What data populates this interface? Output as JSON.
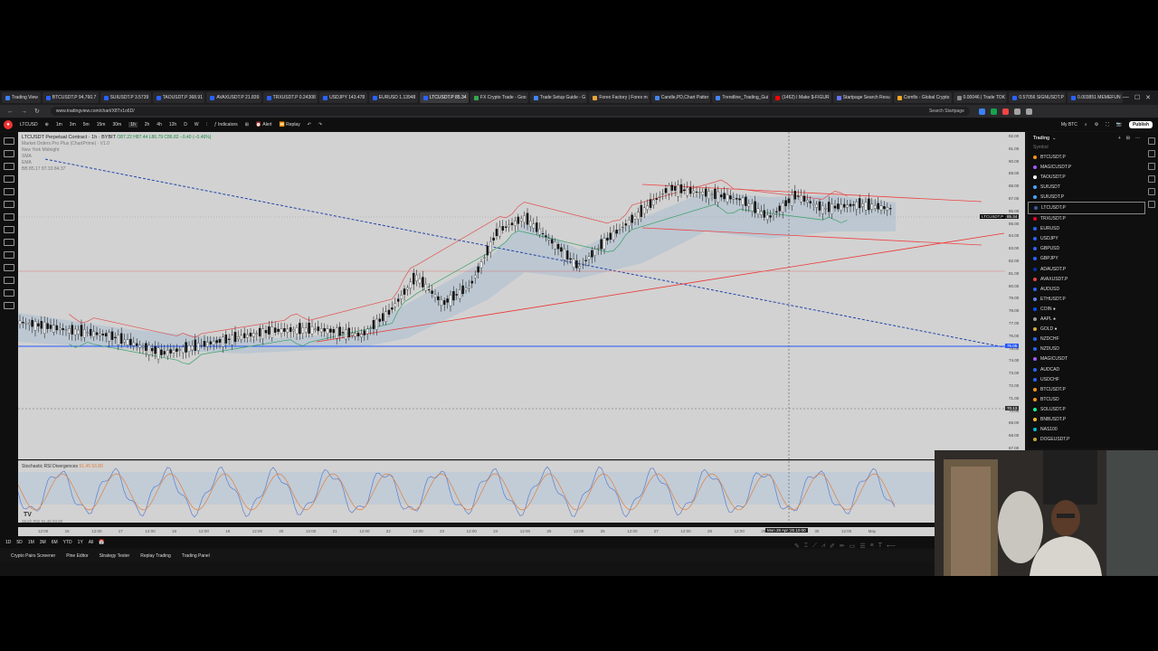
{
  "browser": {
    "tabs": [
      {
        "label": "Trading View",
        "color": "#3b82f6"
      },
      {
        "label": "BTCUSDT.P 94,760.7",
        "color": "#2962ff"
      },
      {
        "label": "SUIUSDT.P 3.5739",
        "color": "#2962ff"
      },
      {
        "label": "TAOUSDT.P 368.91",
        "color": "#2962ff"
      },
      {
        "label": "AVAXUSDT.P 21.839",
        "color": "#2962ff"
      },
      {
        "label": "TRXUSDT.P 0.24308",
        "color": "#2962ff"
      },
      {
        "label": "USDJPY 143.478",
        "color": "#2962ff"
      },
      {
        "label": "EURUSD 1.13948",
        "color": "#2962ff"
      },
      {
        "label": "LTCUSDT.P 85.34",
        "color": "#2962ff",
        "active": true
      },
      {
        "label": "FX Crypto Trade - Goo",
        "color": "#34a853"
      },
      {
        "label": "Trade Setup Guide - G",
        "color": "#4285f4"
      },
      {
        "label": "Forex Factory | Forex m",
        "color": "#e8a33d"
      },
      {
        "label": "Candle,PD,Chart Patter",
        "color": "#4285f4"
      },
      {
        "label": "Trendline_Trading_Gui",
        "color": "#4285f4"
      },
      {
        "label": "(1462) I Make $-FIGUR",
        "color": "#ff0000"
      },
      {
        "label": "Startpage Search Resu",
        "color": "#6573ff"
      },
      {
        "label": "Comfix - Global Crypto",
        "color": "#f5a623"
      },
      {
        "label": "0.00046 | Trade TOK",
        "color": "#888888"
      },
      {
        "label": "0.57056 SIGNUSDT.P",
        "color": "#2962ff"
      },
      {
        "label": "0.003851 MEMEFUN",
        "color": "#2962ff"
      }
    ],
    "url": "www.tradingview.com/chart/X8Tv1o6D/",
    "search_placeholder": "Search Startpage"
  },
  "toolbar": {
    "symbol": "LTCUSD",
    "intervals": [
      "1m",
      "3m",
      "5m",
      "15m",
      "30m",
      "1h",
      "2h",
      "4h",
      "12h",
      "D",
      "W"
    ],
    "indicators_label": "Indicators",
    "alert_label": "Alert",
    "replay_label": "Replay",
    "layout_label": "My BTC",
    "publish_label": "Publish"
  },
  "chart": {
    "title": "LTCUSDT Perpetual Contract · 1h · BYBIT",
    "ohlc": "O87.22 H87.44 L86.79 C86.82 −0.40 (−0.46%)",
    "indicator1": "Market Orders Pro Plus (ChartPrime) · V1.0",
    "session": "New York Midnight",
    "ma1": "SMA",
    "ma2": "EMA",
    "bb": "BB 85.17 87.33 84.37",
    "price_labels": [
      "92.00",
      "91.00",
      "90.00",
      "89.00",
      "88.00",
      "87.00",
      "86.00",
      "85.00",
      "84.00",
      "83.00",
      "82.00",
      "81.00",
      "80.00",
      "79.00",
      "78.00",
      "77.00",
      "76.00",
      "75.00",
      "74.00",
      "73.00",
      "72.00",
      "71.00",
      "70.00",
      "69.00",
      "68.00",
      "67.00"
    ],
    "current_price": "85.34",
    "symbol_tag": "LTCUSDT.P",
    "blue_line_price": "75.05",
    "dotted_line_price": "70.13",
    "crosshair_time": "Mon 28 Apr '25 10:00"
  },
  "oscillator": {
    "name": "Stochastic RSI Divergences",
    "values": "91.45 93.80",
    "sub_label": "Stoch RSI 91.45 93.80"
  },
  "time_axis": {
    "labels": [
      "12:00",
      "16",
      "12:00",
      "17",
      "12:00",
      "18",
      "12:00",
      "19",
      "12:00",
      "20",
      "12:00",
      "21",
      "12:00",
      "22",
      "12:00",
      "23",
      "12:00",
      "24",
      "12:00",
      "25",
      "12:00",
      "26",
      "12:00",
      "27",
      "12:00",
      "28",
      "12:00",
      "29",
      "12:00",
      "30",
      "12:00",
      "May"
    ]
  },
  "bottom": {
    "ranges": [
      "1D",
      "5D",
      "1M",
      "3M",
      "6M",
      "YTD",
      "1Y",
      "All"
    ],
    "panels": [
      "Crypto Pairs Screener",
      "Pine Editor",
      "Strategy Tester",
      "Replay Trading",
      "Trading Panel"
    ]
  },
  "watchlist": {
    "title": "Trading",
    "column": "Symbol",
    "items": [
      {
        "label": "BTCUSDT.P",
        "color": "#f7931a"
      },
      {
        "label": "MAGICUSDT.P",
        "color": "#a259ff"
      },
      {
        "label": "TAOUSDT.P",
        "color": "#ffffff"
      },
      {
        "label": "SUIUSDT",
        "color": "#4da2ff"
      },
      {
        "label": "SUIUSDT.P",
        "color": "#4da2ff"
      },
      {
        "label": "LTCUSDT.P",
        "color": "#345d9d",
        "selected": true
      },
      {
        "label": "TRXUSDT.P",
        "color": "#ef0027"
      },
      {
        "label": "EURUSD",
        "color": "#2962ff"
      },
      {
        "label": "USDJPY",
        "color": "#2962ff"
      },
      {
        "label": "GBPUSD",
        "color": "#2962ff"
      },
      {
        "label": "GBPJPY",
        "color": "#2962ff"
      },
      {
        "label": "ADAUSDT.P",
        "color": "#0033ad"
      },
      {
        "label": "AVAXUSDT.P",
        "color": "#e84142"
      },
      {
        "label": "AUDUSD",
        "color": "#2962ff"
      },
      {
        "label": "ETHUSDT.P",
        "color": "#627eea"
      },
      {
        "label": "COIN ●",
        "color": "#0052ff"
      },
      {
        "label": "AAPL ●",
        "color": "#999999"
      },
      {
        "label": "GOLD ●",
        "color": "#d4af37"
      },
      {
        "label": "NZDCHF",
        "color": "#2962ff"
      },
      {
        "label": "NZDUSD",
        "color": "#2962ff"
      },
      {
        "label": "MAGICUSDT",
        "color": "#a259ff"
      },
      {
        "label": "AUDCAD",
        "color": "#2962ff"
      },
      {
        "label": "USDCHF",
        "color": "#2962ff"
      },
      {
        "label": "BTCUSDT.P",
        "color": "#f7931a"
      },
      {
        "label": "BTCUSD",
        "color": "#f7931a"
      },
      {
        "label": "SOLUSDT.P",
        "color": "#14f195"
      },
      {
        "label": "BNBUSDT.P",
        "color": "#f3ba2f"
      },
      {
        "label": "NAS100",
        "color": "#00bcd4"
      },
      {
        "label": "DOGEUSDT.P",
        "color": "#c2a633"
      }
    ]
  }
}
